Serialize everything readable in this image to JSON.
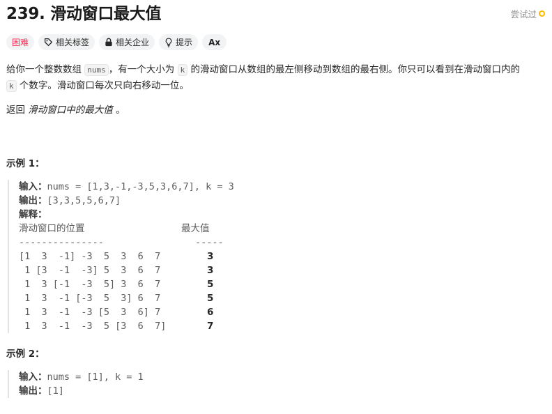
{
  "problem": {
    "title": "239. 滑动窗口最大值",
    "status": "尝试过"
  },
  "tags": {
    "difficulty": "困难",
    "related_tags": "相关标签",
    "related_companies": "相关企业",
    "hint": "提示",
    "ax": "Ax"
  },
  "description": {
    "p1_a": "给你一个整数数组 ",
    "p1_code1": "nums",
    "p1_b": "，有一个大小为 ",
    "p1_code2": "k",
    "p1_c": " 的滑动窗口从数组的最左侧移动到数组的最右侧。你只可以看到在滑动窗口内的",
    "p1_code3": "k",
    "p1_d": " 个数字。滑动窗口每次只向右移动一位。",
    "ret_a": "返回 ",
    "ret_em": "滑动窗口中的最大值",
    "ret_b": " 。"
  },
  "example1": {
    "heading": "示例 1：",
    "input_label": "输入：",
    "input_value": "nums = [1,3,-1,-3,5,3,6,7], k = 3",
    "output_label": "输出：",
    "output_value": "[3,3,5,5,6,7]",
    "explain_label": "解释：",
    "col1_header": "滑动窗口的位置",
    "col2_header": "最大值",
    "dashes1": "---------------",
    "dashes2": "-----",
    "rows": [
      {
        "window": "[1  3  -1] -3  5  3  6  7",
        "max": "3"
      },
      {
        "window": " 1 [3  -1  -3] 5  3  6  7",
        "max": "3"
      },
      {
        "window": " 1  3 [-1  -3  5] 3  6  7",
        "max": "5"
      },
      {
        "window": " 1  3  -1 [-3  5  3] 6  7",
        "max": "5"
      },
      {
        "window": " 1  3  -1  -3 [5  3  6] 7",
        "max": "6"
      },
      {
        "window": " 1  3  -1  -3  5 [3  6  7]",
        "max": "7"
      }
    ]
  },
  "example2": {
    "heading": "示例 2：",
    "input_label": "输入：",
    "input_value": "nums = [1], k = 1",
    "output_label": "输出：",
    "output_value": "[1]"
  },
  "colors": {
    "hard": "#ff2d55",
    "attempted_ring": "#ffb800",
    "tag_bg": "#f2f3f4"
  }
}
